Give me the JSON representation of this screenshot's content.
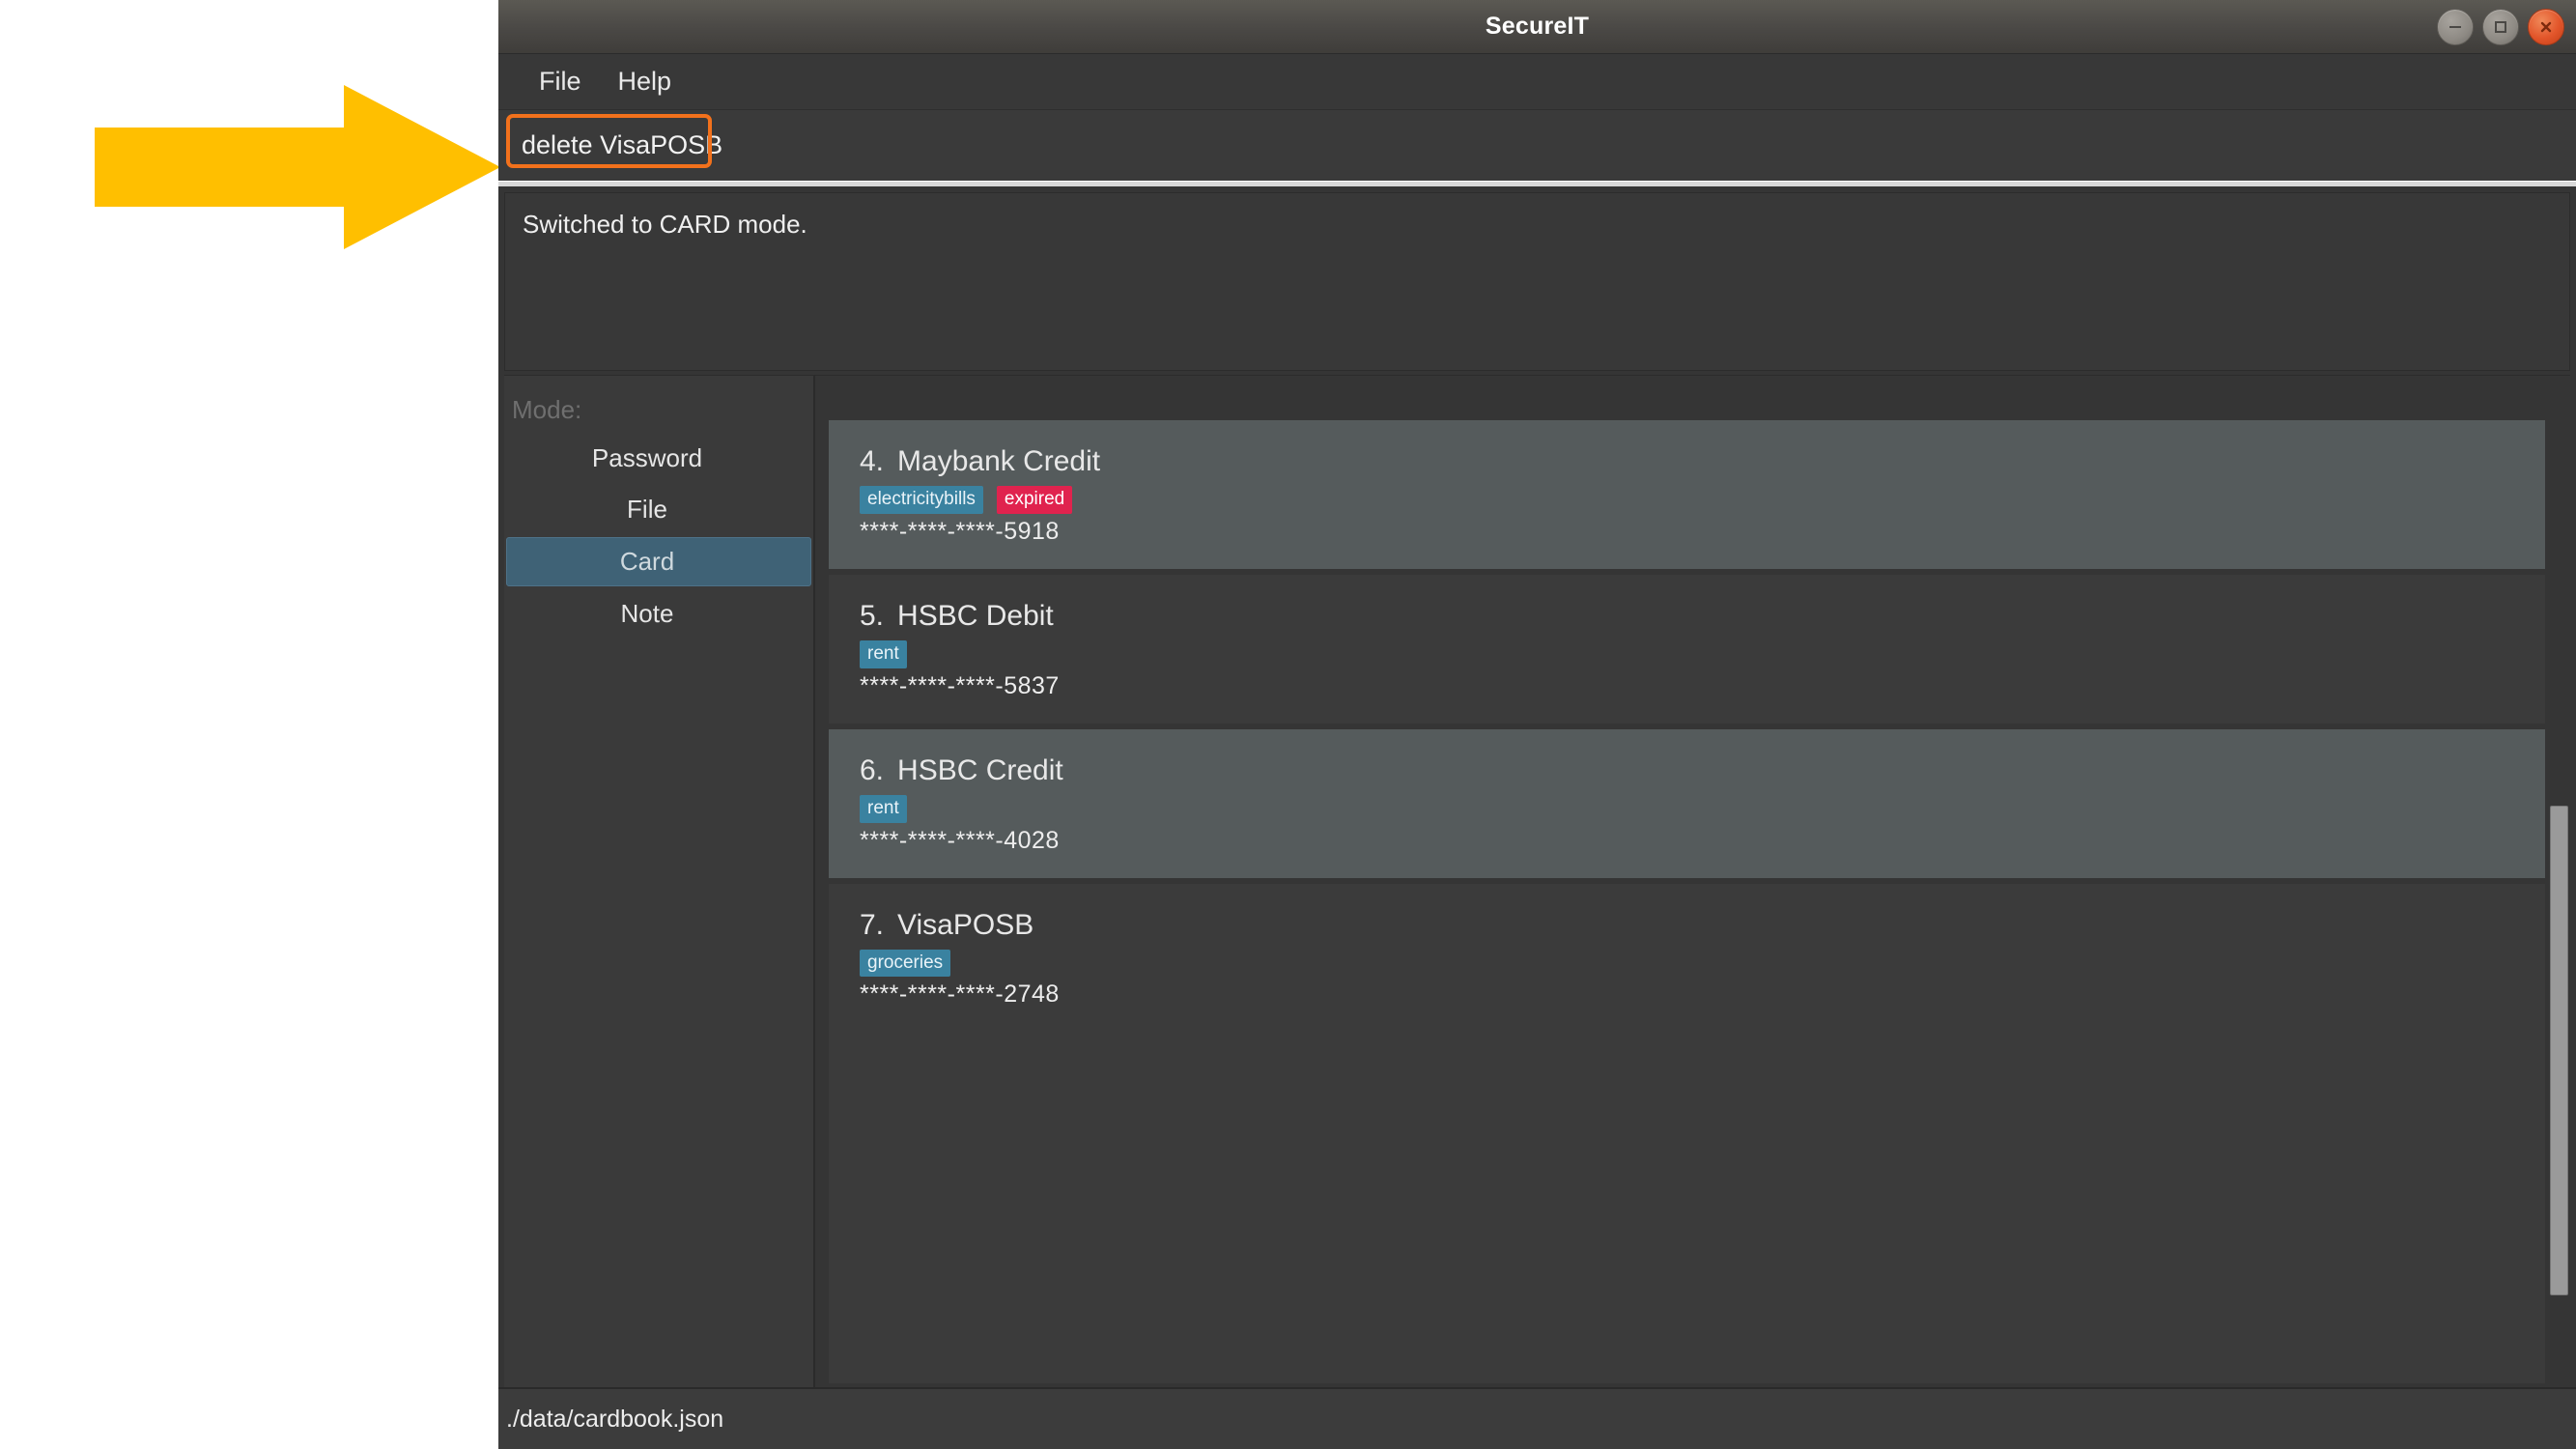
{
  "window": {
    "title": "SecureIT",
    "controls": [
      {
        "name": "minimize",
        "glyph": "minimize-icon"
      },
      {
        "name": "maximize",
        "glyph": "maximize-icon"
      },
      {
        "name": "close",
        "glyph": "close-icon"
      }
    ]
  },
  "menu": {
    "items": [
      {
        "label": "File"
      },
      {
        "label": "Help"
      }
    ]
  },
  "command": {
    "value": "delete VisaPOSB",
    "placeholder": ""
  },
  "output": {
    "text": "Switched to CARD mode."
  },
  "sidebar": {
    "mode_label": "Mode:",
    "items": [
      {
        "label": "Password",
        "selected": false
      },
      {
        "label": "File",
        "selected": false
      },
      {
        "label": "Card",
        "selected": true
      },
      {
        "label": "Note",
        "selected": false
      }
    ]
  },
  "card_list": {
    "entries": [
      {
        "index": "4.",
        "title": "Maybank Credit",
        "tags": [
          {
            "text": "electricitybills",
            "color": "blue"
          },
          {
            "text": "expired",
            "color": "red"
          }
        ],
        "number": "****-****-****-5918",
        "highlighted": true
      },
      {
        "index": "5.",
        "title": "HSBC Debit",
        "tags": [
          {
            "text": "rent",
            "color": "blue"
          }
        ],
        "number": "****-****-****-5837",
        "highlighted": false
      },
      {
        "index": "6.",
        "title": "HSBC Credit",
        "tags": [
          {
            "text": "rent",
            "color": "blue"
          }
        ],
        "number": "****-****-****-4028",
        "highlighted": true
      },
      {
        "index": "7.",
        "title": "VisaPOSB",
        "tags": [
          {
            "text": "groceries",
            "color": "blue"
          }
        ],
        "number": "****-****-****-2748",
        "highlighted": false
      }
    ]
  },
  "status_bar": {
    "path": "./data/cardbook.json"
  },
  "annotation": {
    "arrow_color": "#FFBF00",
    "highlight_color": "#F2711C"
  },
  "colors": {
    "window_bg": "#353535",
    "panel_bg": "#3b3b3b",
    "selected_mode_bg": "#3f6276",
    "tag_blue": "#3a82a0",
    "tag_red": "#e0234e",
    "close_button": "#e2552a"
  }
}
